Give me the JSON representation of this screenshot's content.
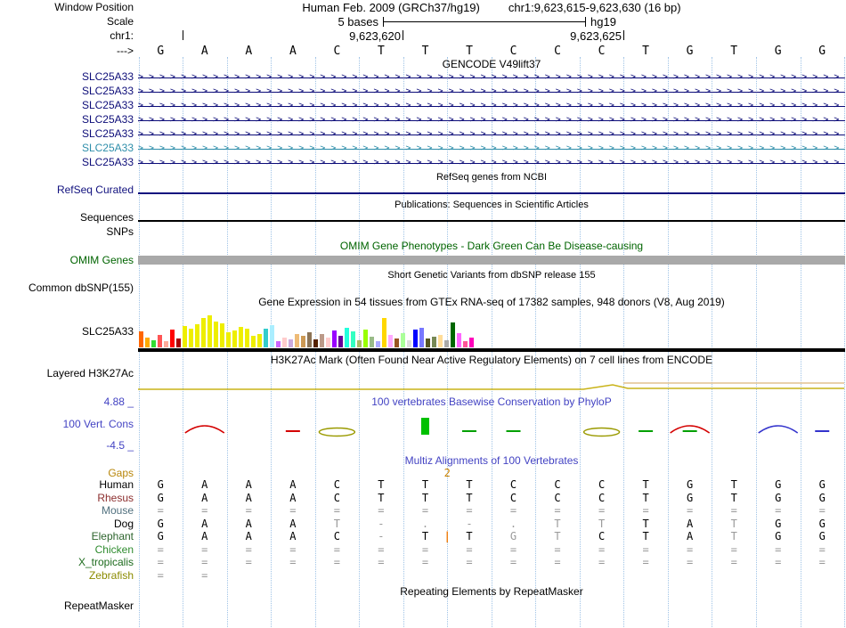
{
  "header": {
    "window_position_label": "Window Position",
    "assembly_title": "Human Feb. 2009 (GRCh37/hg19)",
    "position_title": "chr1:9,623,615-9,623,630 (16 bp)",
    "scale_label": "Scale",
    "scale_value": "5 bases",
    "genome": "hg19",
    "chrom_label": "chr1:",
    "ruler_tick_labels": [
      "9,623,620",
      "9,623,625"
    ],
    "strand_label": "--->",
    "bases": [
      "G",
      "A",
      "A",
      "A",
      "C",
      "T",
      "T",
      "T",
      "C",
      "C",
      "C",
      "T",
      "G",
      "T",
      "G",
      "G"
    ]
  },
  "colors": {
    "gridline": "#9fc3e6",
    "gencode_dark_blue": "#0c0c78",
    "gencode_light_blue": "#2e8eaa",
    "refseq_navy": "#10107e",
    "omim_dark_green": "#006400",
    "omim_bar_gray": "#a9a9a9",
    "conservation_blue": "#4343c3",
    "gaps_orange": "#b8860b"
  },
  "gencode": {
    "header": "GENCODE V49lift37",
    "genes": [
      {
        "label": "SLC25A33",
        "color": "#0c0c78"
      },
      {
        "label": "SLC25A33",
        "color": "#0c0c78"
      },
      {
        "label": "SLC25A33",
        "color": "#0c0c78"
      },
      {
        "label": "SLC25A33",
        "color": "#0c0c78"
      },
      {
        "label": "SLC25A33",
        "color": "#0c0c78"
      },
      {
        "label": "SLC25A33",
        "color": "#2e8eaa"
      },
      {
        "label": "SLC25A33",
        "color": "#0c0c78"
      }
    ]
  },
  "refseq": {
    "header": "RefSeq genes from NCBI",
    "label": "RefSeq Curated",
    "color": "#10107e"
  },
  "publications": {
    "header": "Publications: Sequences in Scientific Articles",
    "label": "Sequences"
  },
  "snps": {
    "label": "SNPs"
  },
  "omim": {
    "header": "OMIM Gene Phenotypes - Dark Green Can Be Disease-causing",
    "label": "OMIM Genes",
    "bar_color": "#a9a9a9"
  },
  "dbsnp": {
    "header": "Short Genetic Variants from dbSNP release 155",
    "label": "Common dbSNP(155)"
  },
  "gtex": {
    "header": "Gene Expression in 54 tissues from GTEx RNA-seq of 17382 samples, 948 donors (V8, Aug 2019)",
    "label": "SLC25A33",
    "bars": [
      [
        18,
        "#FF6600"
      ],
      [
        11,
        "#FFAA00"
      ],
      [
        8,
        "#33DD33"
      ],
      [
        14,
        "#FF5555"
      ],
      [
        7,
        "#FFAA99"
      ],
      [
        20,
        "#FF0000"
      ],
      [
        10,
        "#AA0000"
      ],
      [
        24,
        "#EEEE00"
      ],
      [
        21,
        "#EEEE00"
      ],
      [
        26,
        "#EEEE00"
      ],
      [
        33,
        "#EEEE00"
      ],
      [
        36,
        "#EEEE00"
      ],
      [
        29,
        "#EEEE00"
      ],
      [
        27,
        "#EEEE00"
      ],
      [
        17,
        "#EEEE00"
      ],
      [
        19,
        "#EEEE00"
      ],
      [
        23,
        "#EEEE00"
      ],
      [
        21,
        "#EEEE00"
      ],
      [
        13,
        "#EEEE00"
      ],
      [
        15,
        "#EEEE00"
      ],
      [
        21,
        "#33CCCC"
      ],
      [
        25,
        "#AAEEFF"
      ],
      [
        7,
        "#CC66FF"
      ],
      [
        11,
        "#FFCCCC"
      ],
      [
        9,
        "#CCAADD"
      ],
      [
        15,
        "#EEBB77"
      ],
      [
        13,
        "#CC9955"
      ],
      [
        17,
        "#8B7355"
      ],
      [
        9,
        "#552200"
      ],
      [
        15,
        "#BB9988"
      ],
      [
        11,
        "#FFCCCC"
      ],
      [
        19,
        "#9900FF"
      ],
      [
        13,
        "#660099"
      ],
      [
        22,
        "#22FFDD"
      ],
      [
        18,
        "#33FFC2"
      ],
      [
        8,
        "#AABB66"
      ],
      [
        20,
        "#99FF00"
      ],
      [
        12,
        "#99BB88"
      ],
      [
        7,
        "#AAAAFF"
      ],
      [
        33,
        "#FFD700"
      ],
      [
        14,
        "#FFAAFF"
      ],
      [
        10,
        "#995522"
      ],
      [
        16,
        "#AAFF99"
      ],
      [
        8,
        "#DDDDDD"
      ],
      [
        20,
        "#0000FF"
      ],
      [
        22,
        "#7777FF"
      ],
      [
        10,
        "#555522"
      ],
      [
        12,
        "#778855"
      ],
      [
        14,
        "#FFDD99"
      ],
      [
        8,
        "#AAAAAA"
      ],
      [
        28,
        "#006600"
      ],
      [
        16,
        "#FF66FF"
      ],
      [
        7,
        "#FF5599"
      ],
      [
        11,
        "#FF00BB"
      ]
    ]
  },
  "h3k27ac": {
    "header": "H3K27Ac Mark (Often Found Near Active Regulatory Elements) on 7 cell lines from ENCODE",
    "label": "Layered H3K27Ac",
    "lines": [
      {
        "color": "#c9b318",
        "points": [
          [
            155,
            12
          ],
          [
            480,
            12
          ],
          [
            655,
            12
          ],
          [
            688,
            7
          ],
          [
            705,
            11
          ],
          [
            948,
            11
          ]
        ]
      },
      {
        "color": "#e2c28f",
        "points": [
          [
            700,
            5
          ],
          [
            948,
            5
          ]
        ]
      }
    ]
  },
  "conservation": {
    "header": "100 vertebrates Basewise Conservation by PhyloP",
    "label": "100 Vert. Cons",
    "max_label": "4.88 _",
    "min_label": "-4.5 _",
    "marks": [
      {
        "col": 1,
        "type": "arc",
        "color": "#d40000"
      },
      {
        "col": 3,
        "type": "dash",
        "color": "#d40000"
      },
      {
        "col": 4,
        "type": "ellipse",
        "color": "#9a9a00"
      },
      {
        "col": 6,
        "type": "bar",
        "color": "#00c000"
      },
      {
        "col": 7,
        "type": "dash",
        "color": "#00a000"
      },
      {
        "col": 8,
        "type": "dash",
        "color": "#00a000"
      },
      {
        "col": 10,
        "type": "ellipse",
        "color": "#9a9a00"
      },
      {
        "col": 11,
        "type": "dash",
        "color": "#00a000"
      },
      {
        "col": 12,
        "type": "arc",
        "color": "#d40000"
      },
      {
        "col": 12,
        "type": "dash",
        "color": "#00a000"
      },
      {
        "col": 14,
        "type": "arc",
        "color": "#3333cc"
      },
      {
        "col": 15,
        "type": "dash",
        "color": "#3333cc"
      }
    ]
  },
  "multiz": {
    "header": "Multiz Alignments of 100 Vertebrates",
    "gaps_label": "Gaps",
    "gap_value": "2",
    "gap_col": 7,
    "gap_color": "#cc8400",
    "insert_color": "#f07800",
    "rows": [
      {
        "name": "Human",
        "color": "#000000",
        "cells": [
          "G",
          "A",
          "A",
          "A",
          "C",
          "T",
          "T",
          "T",
          "C",
          "C",
          "C",
          "T",
          "G",
          "T",
          "G",
          "G"
        ]
      },
      {
        "name": "Rhesus",
        "color": "#8b2d2d",
        "cells": [
          "G",
          "A",
          "A",
          "A",
          "C",
          "T",
          "T",
          "T",
          "C",
          "C",
          "C",
          "T",
          "G",
          "T",
          "G",
          "G"
        ]
      },
      {
        "name": "Mouse",
        "color": "#50707e",
        "cells": [
          "=",
          "=",
          "=",
          "=",
          "=",
          "=",
          "=",
          "=",
          "=",
          "=",
          "=",
          "=",
          "=",
          "=",
          "=",
          "="
        ]
      },
      {
        "name": "Dog",
        "color": "#000000",
        "cells": [
          "G",
          "A",
          "A",
          "A",
          "T",
          "-",
          ".",
          "-",
          ".",
          "T",
          "T",
          "T",
          "A",
          "T",
          "G",
          "G"
        ],
        "gray": [
          4,
          5,
          6,
          7,
          8,
          9,
          10,
          13
        ]
      },
      {
        "name": "Elephant",
        "color": "#2d642d",
        "cells": [
          "G",
          "A",
          "A",
          "A",
          "C",
          "-",
          "T",
          "T",
          "G",
          "T",
          "C",
          "T",
          "A",
          "T",
          "G",
          "G"
        ],
        "gray": [
          5,
          8,
          9,
          13
        ],
        "insert_before": 7
      },
      {
        "name": "Chicken",
        "color": "#2e8b2e",
        "cells": [
          "=",
          "=",
          "=",
          "=",
          "=",
          "=",
          "=",
          "=",
          "=",
          "=",
          "=",
          "=",
          "=",
          "=",
          "=",
          "="
        ]
      },
      {
        "name": "X_tropicalis",
        "color": "#1d6b1d",
        "cells": [
          "=",
          "=",
          "=",
          "=",
          "=",
          "=",
          "=",
          "=",
          "=",
          "=",
          "=",
          "=",
          "=",
          "=",
          "=",
          "="
        ]
      },
      {
        "name": "Zebrafish",
        "color": "#8b8b00",
        "cells": [
          "=",
          "=",
          "",
          "",
          "",
          "",
          "",
          "",
          "",
          "",
          "",
          "",
          "",
          "",
          "",
          ""
        ]
      }
    ]
  },
  "repeatmasker": {
    "header": "Repeating Elements by RepeatMasker",
    "label": "RepeatMasker"
  }
}
